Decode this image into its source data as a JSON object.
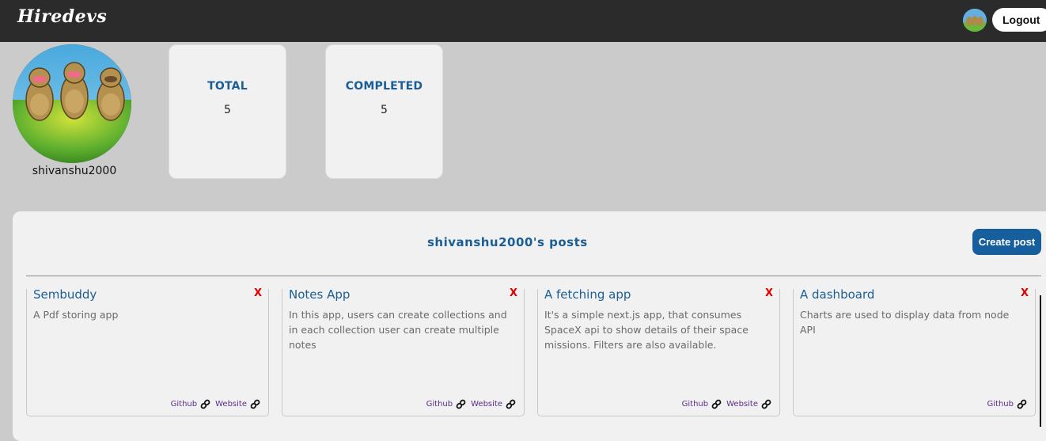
{
  "navbar": {
    "brand": "Hiredevs",
    "logout_label": "Logout"
  },
  "profile": {
    "username": "shivanshu2000"
  },
  "stats": [
    {
      "label": "TOTAL",
      "value": "5"
    },
    {
      "label": "COMPLETED",
      "value": "5"
    }
  ],
  "posts_section": {
    "title": "shivanshu2000's posts",
    "create_label": "Create post"
  },
  "posts": [
    {
      "title": "Sembuddy",
      "delete": "X",
      "description": "A Pdf storing app",
      "github": "Github",
      "website": "Website"
    },
    {
      "title": "Notes App",
      "delete": "X",
      "description": "In this app, users can create collections and in each collection user can create multiple notes",
      "github": "Github",
      "website": "Website"
    },
    {
      "title": "A fetching app",
      "delete": "X",
      "description": "It's a simple next.js app, that consumes SpaceX api to show details of their space missions. Filters are also available.",
      "github": "Github",
      "website": "Website"
    },
    {
      "title": "A dashboard",
      "delete": "X",
      "description": "Charts are used to display data from node API",
      "github": "Github"
    }
  ]
}
